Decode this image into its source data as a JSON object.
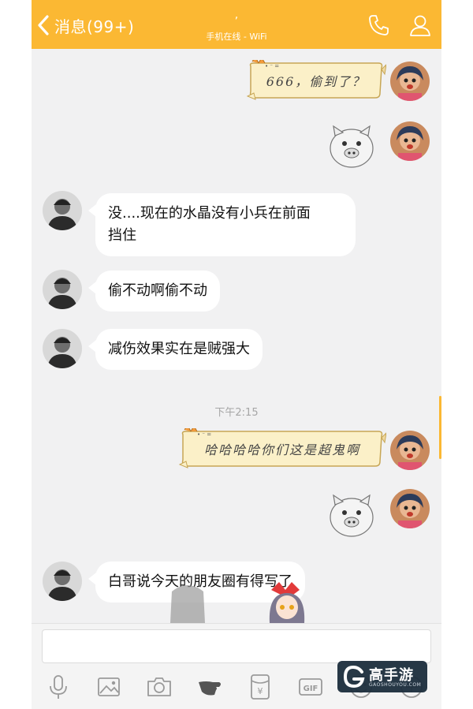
{
  "header": {
    "back_label": "消息(99+)",
    "title": ",",
    "subtitle": "手机在线 - WiFi",
    "background": "#fbb833"
  },
  "messages": [
    {
      "side": "right",
      "type": "cat-bubble",
      "text": "666，偷到了？"
    },
    {
      "side": "right",
      "type": "sticker",
      "sticker": "pig-face"
    },
    {
      "side": "left",
      "type": "text",
      "lines": [
        "没....现在的水晶没有小兵在前面",
        "挡住"
      ]
    },
    {
      "side": "left",
      "type": "text",
      "lines": [
        "偷不动啊偷不动"
      ]
    },
    {
      "side": "left",
      "type": "text",
      "lines": [
        "减伤效果实在是贼强大"
      ]
    },
    {
      "side": "right",
      "type": "cat-bubble",
      "text": "哈哈哈哈你们这是超鬼啊"
    },
    {
      "side": "right",
      "type": "sticker",
      "sticker": "pig-face"
    },
    {
      "side": "left",
      "type": "text",
      "lines": [
        "白哥说今天的朋友圈有得写了"
      ]
    }
  ],
  "timestamp": "下午2:15",
  "input": {
    "placeholder": "",
    "value": ""
  },
  "toolbar": [
    "microphone-icon",
    "image-icon",
    "camera-icon",
    "shake-icon",
    "red-packet-icon",
    "gif-icon",
    "emoji-icon",
    "more-icon"
  ],
  "watermark": {
    "brand": "高手游",
    "url": "GAOSHOUYOU.COM"
  }
}
